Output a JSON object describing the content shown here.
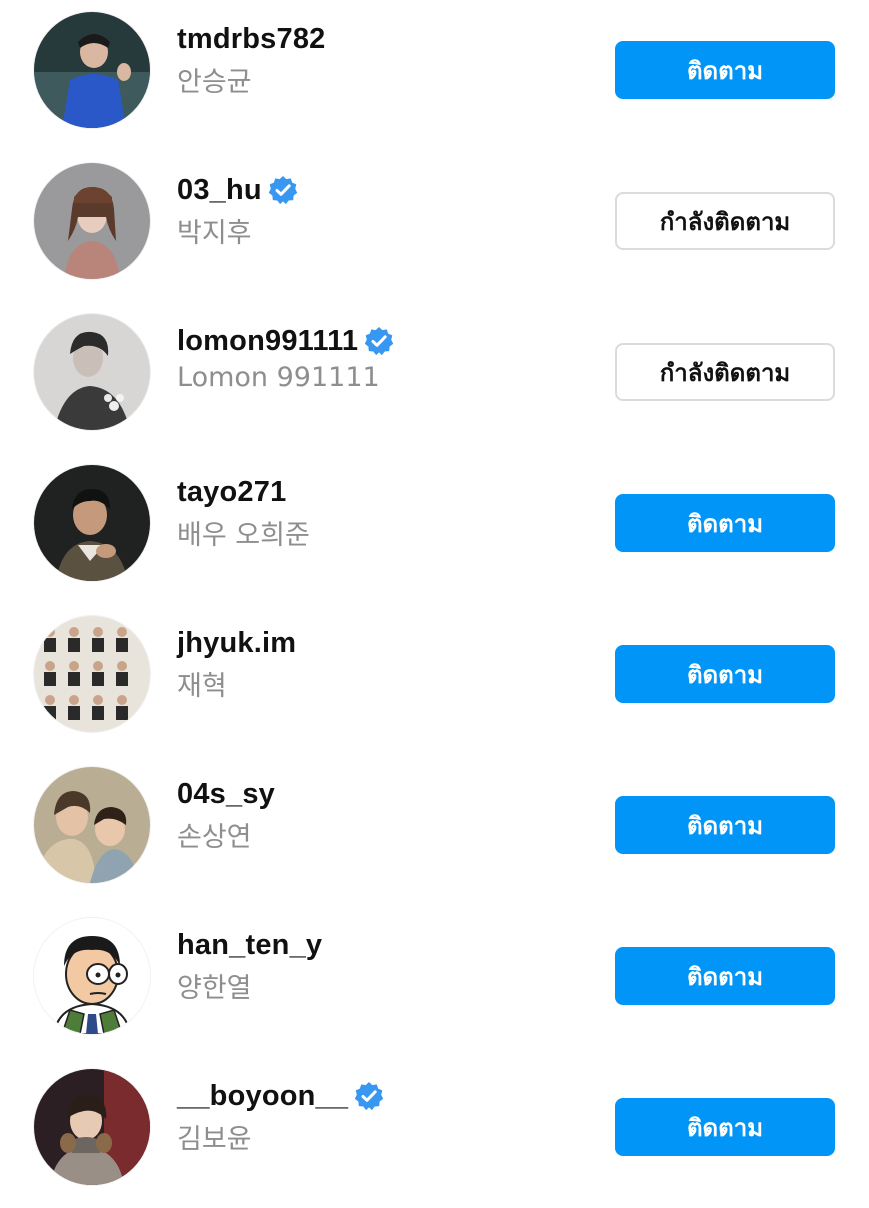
{
  "colors": {
    "follow_button": "#0095f6",
    "verified_badge": "#3897f0",
    "secondary_text": "#8e8e8e"
  },
  "labels": {
    "follow": "ติดตาม",
    "following": "กำลังติดตาม"
  },
  "accounts": [
    {
      "username": "tmdrbs782",
      "full_name": "안승균",
      "verified": false,
      "status": "follow",
      "button_label": "ติดตาม"
    },
    {
      "username": "03_hu",
      "full_name": "박지후",
      "verified": true,
      "status": "following",
      "button_label": "กำลังติดตาม"
    },
    {
      "username": "lomon991111",
      "full_name": "Lomon 991111",
      "verified": true,
      "status": "following",
      "button_label": "กำลังติดตาม"
    },
    {
      "username": "tayo271",
      "full_name": "배우 오희준",
      "verified": false,
      "status": "follow",
      "button_label": "ติดตาม"
    },
    {
      "username": "jhyuk.im",
      "full_name": "재혁",
      "verified": false,
      "status": "follow",
      "button_label": "ติดตาม"
    },
    {
      "username": "04s_sy",
      "full_name": "손상연",
      "verified": false,
      "status": "follow",
      "button_label": "ติดตาม"
    },
    {
      "username": "han_ten_y",
      "full_name": "양한열",
      "verified": false,
      "status": "follow",
      "button_label": "ติดตาม"
    },
    {
      "username": "__boyoon__",
      "full_name": "김보윤",
      "verified": true,
      "status": "follow",
      "button_label": "ติดตาม"
    }
  ]
}
